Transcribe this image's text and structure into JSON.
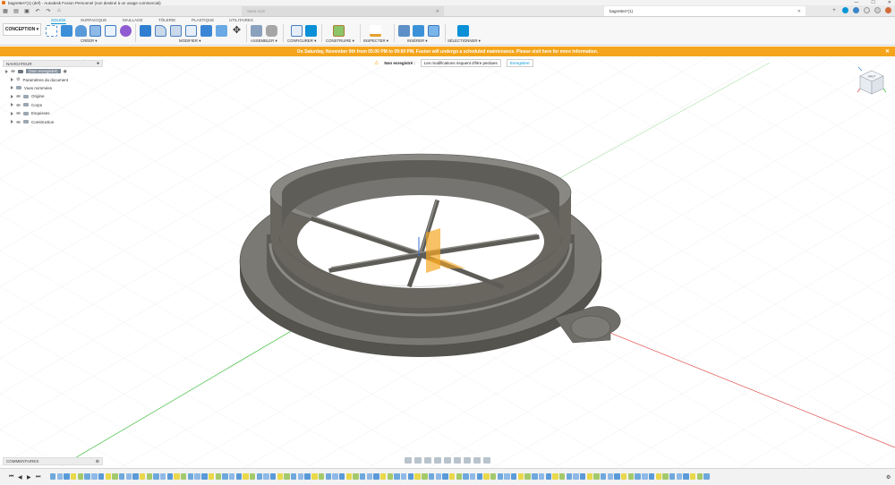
{
  "window": {
    "title": "bagrettes*(1) (def) - Autodesk Fusion Personnel (non destiné à un usage commercial)",
    "controls": [
      "—",
      "☐",
      "✕"
    ]
  },
  "tabs": {
    "inactive": "Sans nom",
    "active": "bagrettes*(1)"
  },
  "toolbar": {
    "workspace": "CONCEPTION ▾",
    "ribbon_tabs": [
      "SOLIDE",
      "SURFACIQUE",
      "MAILLAGE",
      "TÔLERIE",
      "PLASTIQUE",
      "UTILITAIRES"
    ],
    "active_tab": "SOLIDE",
    "groups": [
      "CRÉER ▾",
      "MODIFIER ▾",
      "ASSEMBLER ▾",
      "CONFIGURER ▾",
      "CONSTRUIRE ▾",
      "INSPECTER ▾",
      "INSÉRER ▾",
      "SÉLECTIONNER ▾"
    ]
  },
  "banner": {
    "text": "On Saturday, November 9th from 05:00 PM to 09:00 PM, Fusion will undergo a scheduled maintenance. Please visit here for more information."
  },
  "unsaved": {
    "label": "Non enregistré :",
    "message": "Les modifications risquent d'être perdues",
    "button": "Enregistrer"
  },
  "browser": {
    "title": "NAVIGATEUR",
    "root": "(Non enregistré)",
    "items": [
      "Paramètres du document",
      "Vues nommées",
      "Origine",
      "Corps",
      "Esquisses",
      "Construction"
    ]
  },
  "comments": {
    "title": "COMMENTAIRES"
  },
  "viewcube": {
    "label": "HAUT"
  },
  "colors": {
    "accent": "#0696d7",
    "banner": "#f4a51c",
    "model": "#6c6a64",
    "axis_x": "#e05050",
    "axis_z": "#3cbf3c"
  },
  "timeline": {
    "item_count": 96
  }
}
